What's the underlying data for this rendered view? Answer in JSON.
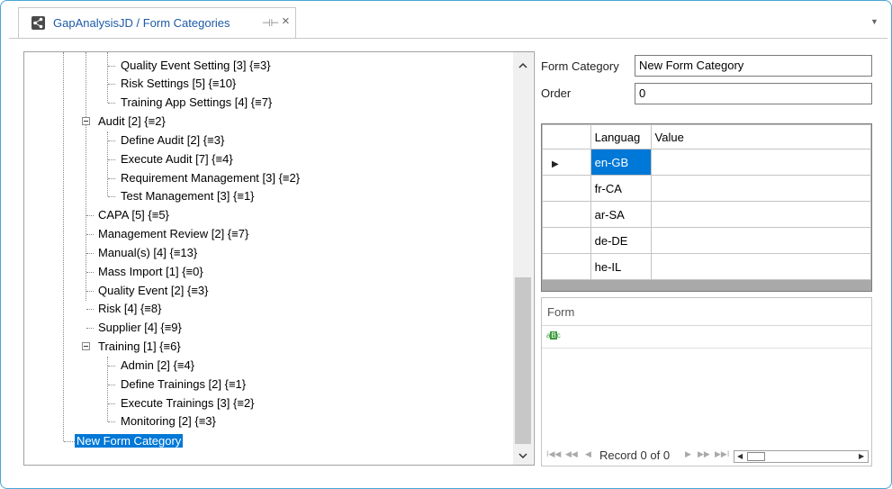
{
  "tab": {
    "title": "GapAnalysisJD / Form Categories",
    "pin": "⊣⊢",
    "close": "×"
  },
  "tree": {
    "nodes": [
      "Quality Event Setting [3] {≡3}",
      "Risk Settings [5] {≡10}",
      "Training App Settings [4] {≡7}",
      "Audit [2] {≡2}",
      "Define Audit [2] {≡3}",
      "Execute Audit [7] {≡4}",
      "Requirement Management  [3] {≡2}",
      "Test Management [3] {≡1}",
      "CAPA [5] {≡5}",
      "Management Review [2] {≡7}",
      "Manual(s) [4] {≡13}",
      "Mass Import [1] {≡0}",
      "Quality Event [2] {≡3}",
      "Risk [4] {≡8}",
      "Supplier [4] {≡9}",
      "Training [1] {≡6}",
      "Admin [2] {≡4}",
      "Define Trainings [2] {≡1}",
      "Execute Trainings [3] {≡2}",
      "Monitoring [2] {≡3}",
      "New Form Category"
    ]
  },
  "form": {
    "form_category_label": "Form Category",
    "form_category_value": "New Form Category",
    "order_label": "Order",
    "order_value": "0"
  },
  "grid": {
    "columns": [
      "Languag",
      "Value"
    ],
    "rows": [
      {
        "lang": "en-GB",
        "value": ""
      },
      {
        "lang": "fr-CA",
        "value": ""
      },
      {
        "lang": "ar-SA",
        "value": ""
      },
      {
        "lang": "de-DE",
        "value": ""
      },
      {
        "lang": "he-IL",
        "value": ""
      }
    ]
  },
  "form_list": {
    "header": "Form",
    "record_text": "Record 0 of 0"
  },
  "colors": {
    "accent": "#0078d7",
    "border": "#49a5d8",
    "tab_text": "#1e5aa8"
  }
}
